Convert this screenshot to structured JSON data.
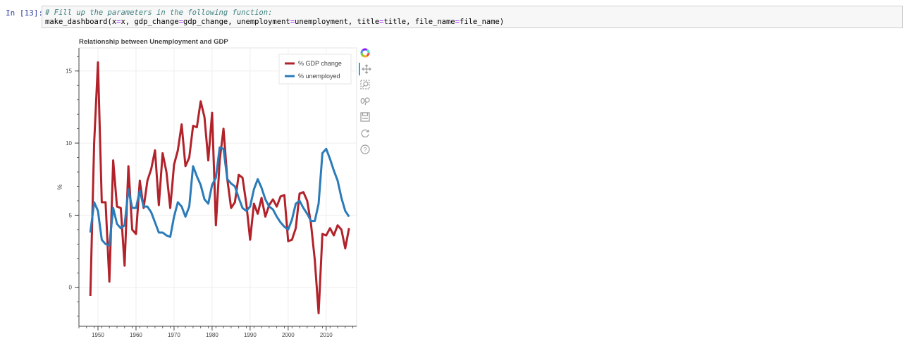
{
  "cell": {
    "prompt": "In [13]:",
    "code_comment": "# Fill up the parameters in the following function:",
    "code_call_prefix": "make_dashboard(x",
    "code_call_parts": [
      "x, gdp_change",
      "gdp_change, unemployment",
      "unemployment, title",
      "title, file_name",
      "file_name)"
    ]
  },
  "toolbar": {
    "tools": [
      "bokeh-logo-icon",
      "pan-icon",
      "box-zoom-icon",
      "wheel-zoom-icon",
      "save-icon",
      "reset-icon",
      "help-icon"
    ]
  },
  "colors": {
    "gdp": "#b2222a",
    "unemployment": "#2b7bb9"
  },
  "chart_data": {
    "type": "line",
    "title": "Relationship between Unemployment and GDP",
    "xlabel": "",
    "ylabel": "%",
    "xlim": [
      1945,
      2018
    ],
    "ylim": [
      -2.7,
      16.6
    ],
    "x_ticks": [
      1950,
      1960,
      1970,
      1980,
      1990,
      2000,
      2010
    ],
    "y_ticks": [
      0,
      5,
      10,
      15
    ],
    "grid": true,
    "legend_position": "top-right",
    "x": [
      1948,
      1949,
      1950,
      1951,
      1952,
      1953,
      1954,
      1955,
      1956,
      1957,
      1958,
      1959,
      1960,
      1961,
      1962,
      1963,
      1964,
      1965,
      1966,
      1967,
      1968,
      1969,
      1970,
      1971,
      1972,
      1973,
      1974,
      1975,
      1976,
      1977,
      1978,
      1979,
      1980,
      1981,
      1982,
      1983,
      1984,
      1985,
      1986,
      1987,
      1988,
      1989,
      1990,
      1991,
      1992,
      1993,
      1994,
      1995,
      1996,
      1997,
      1998,
      1999,
      2000,
      2001,
      2002,
      2003,
      2004,
      2005,
      2006,
      2007,
      2008,
      2009,
      2010,
      2011,
      2012,
      2013,
      2014,
      2015,
      2016
    ],
    "series": [
      {
        "name": "% GDP change",
        "color": "#b2222a",
        "values": [
          -0.6,
          10.0,
          15.6,
          5.9,
          5.9,
          0.4,
          8.8,
          5.6,
          5.5,
          1.5,
          8.4,
          4.0,
          3.7,
          7.4,
          5.5,
          7.4,
          8.2,
          9.5,
          5.7,
          9.3,
          8.0,
          5.5,
          8.5,
          9.5,
          11.3,
          8.4,
          9.0,
          11.2,
          11.1,
          12.9,
          11.8,
          8.8,
          12.1,
          4.3,
          8.8,
          11.0,
          7.5,
          5.5,
          5.9,
          7.8,
          7.6,
          5.8,
          3.3,
          5.8,
          5.1,
          6.2,
          4.9,
          5.7,
          6.1,
          5.6,
          6.3,
          6.4,
          3.2,
          3.3,
          4.1,
          6.5,
          6.6,
          6.0,
          4.4,
          1.9,
          -1.8,
          3.7,
          3.6,
          4.1,
          3.6,
          4.3,
          4.0,
          2.7,
          4.1
        ]
      },
      {
        "name": "% unemployed",
        "color": "#2b7bb9",
        "values": [
          3.8,
          5.9,
          5.3,
          3.3,
          3.0,
          2.9,
          5.5,
          4.4,
          4.1,
          4.3,
          6.8,
          5.5,
          5.5,
          6.7,
          5.6,
          5.6,
          5.2,
          4.5,
          3.8,
          3.8,
          3.6,
          3.5,
          4.9,
          5.9,
          5.6,
          4.9,
          5.6,
          8.4,
          7.7,
          7.1,
          6.1,
          5.8,
          7.1,
          7.6,
          9.7,
          9.6,
          7.5,
          7.2,
          7.0,
          6.2,
          5.5,
          5.3,
          5.6,
          6.8,
          7.5,
          6.9,
          6.1,
          5.6,
          5.4,
          4.9,
          4.5,
          4.2,
          4.0,
          4.7,
          5.8,
          6.0,
          5.5,
          5.1,
          4.6,
          4.6,
          5.8,
          9.3,
          9.6,
          8.9,
          8.1,
          7.4,
          6.2,
          5.3,
          4.9
        ]
      }
    ]
  }
}
